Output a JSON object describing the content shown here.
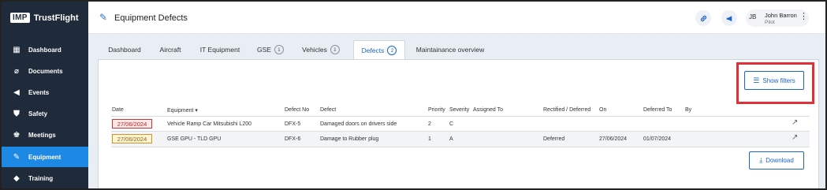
{
  "sidebar": {
    "brand_logo": "IMP",
    "brand_name": "TrustFlight",
    "items": [
      {
        "label": "Dashboard",
        "icon": "dashboard-icon",
        "glyph": "▦"
      },
      {
        "label": "Documents",
        "icon": "paperclip-icon",
        "glyph": "⊘"
      },
      {
        "label": "Events",
        "icon": "megaphone-icon",
        "glyph": "◀"
      },
      {
        "label": "Safety",
        "icon": "shield-icon",
        "glyph": "⛊"
      },
      {
        "label": "Meetings",
        "icon": "people-icon",
        "glyph": "♚"
      },
      {
        "label": "Equipment",
        "icon": "wrench-icon",
        "glyph": "✎",
        "active": true
      },
      {
        "label": "Training",
        "icon": "graduation-cap-icon",
        "glyph": "◆"
      }
    ]
  },
  "header": {
    "title": "Equipment Defects",
    "title_icon": "wrench-icon",
    "link_icon": "link-icon",
    "announce_icon": "megaphone-icon",
    "user": {
      "initials": "JB",
      "name": "John Barron",
      "role": "Pilot"
    }
  },
  "tabs": [
    {
      "label": "Dashboard"
    },
    {
      "label": "Aircraft"
    },
    {
      "label": "IT Equipment"
    },
    {
      "label": "GSE",
      "count": "1"
    },
    {
      "label": "Vehicles",
      "count": "1"
    },
    {
      "label": "Defects",
      "count": "2",
      "active": true
    },
    {
      "label": "Maintainance overview"
    }
  ],
  "toolbar": {
    "show_filters_label": "Show filters",
    "download_label": "Download"
  },
  "table": {
    "columns": [
      "Date",
      "Equipment ▾",
      "Defect No",
      "Defect",
      "Priority",
      "Severity",
      "Assigned To",
      "Rectified / Deferred",
      "On",
      "Deferred To",
      "By"
    ],
    "rows": [
      {
        "date": "27/06/2024",
        "date_status": "overdue",
        "equipment": "Vehicle Ramp Car Mitsubishi L200",
        "defect_no": "DFX-5",
        "defect": "Damaged doors on drivers side",
        "priority": "2",
        "severity": "C",
        "assigned_to": "",
        "rectified_deferred": "",
        "on": "",
        "deferred_to": "",
        "by": ""
      },
      {
        "date": "27/06/2024",
        "date_status": "due",
        "equipment": "GSE GPU - TLD GPU",
        "defect_no": "DFX-6",
        "defect": "Damage to Rubber plug",
        "priority": "1",
        "severity": "A",
        "assigned_to": "",
        "rectified_deferred": "Deferred",
        "on": "27/06/2024",
        "deferred_to": "01/07/2024",
        "by": ""
      }
    ]
  },
  "colors": {
    "sidebar_bg": "#1f2a3a",
    "accent": "#1e64c8",
    "active_nav": "#1e88e5",
    "highlight_box": "#e0303a"
  }
}
